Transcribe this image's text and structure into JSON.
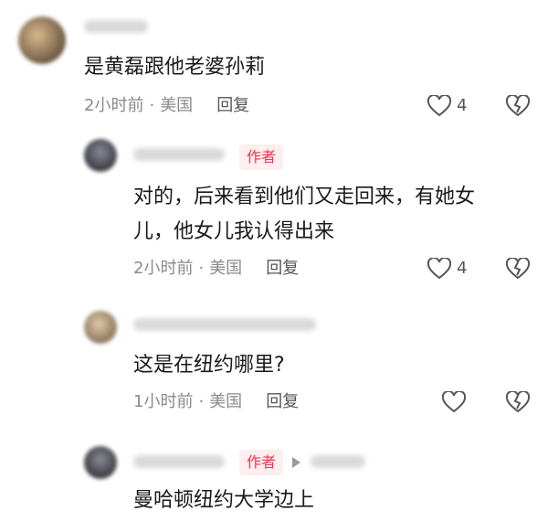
{
  "comments": [
    {
      "text": "是黄磊跟他老婆孙莉",
      "time": "2小时前",
      "location": "美国",
      "reply": "回复",
      "likes": "4"
    },
    {
      "badge": "作者",
      "text_line1": "对的，后来看到他们又走回来，有她女",
      "text_line2": "儿，他女儿我认得出来",
      "time": "2小时前",
      "location": "美国",
      "reply": "回复",
      "likes": "4"
    },
    {
      "text": "这是在纽约哪里?",
      "time": "1小时前",
      "location": "美国",
      "reply": "回复"
    },
    {
      "badge": "作者",
      "text": "曼哈顿纽约大学边上"
    }
  ],
  "colors": {
    "badge_text": "#f2334f",
    "badge_bg": "#fdeef0"
  }
}
